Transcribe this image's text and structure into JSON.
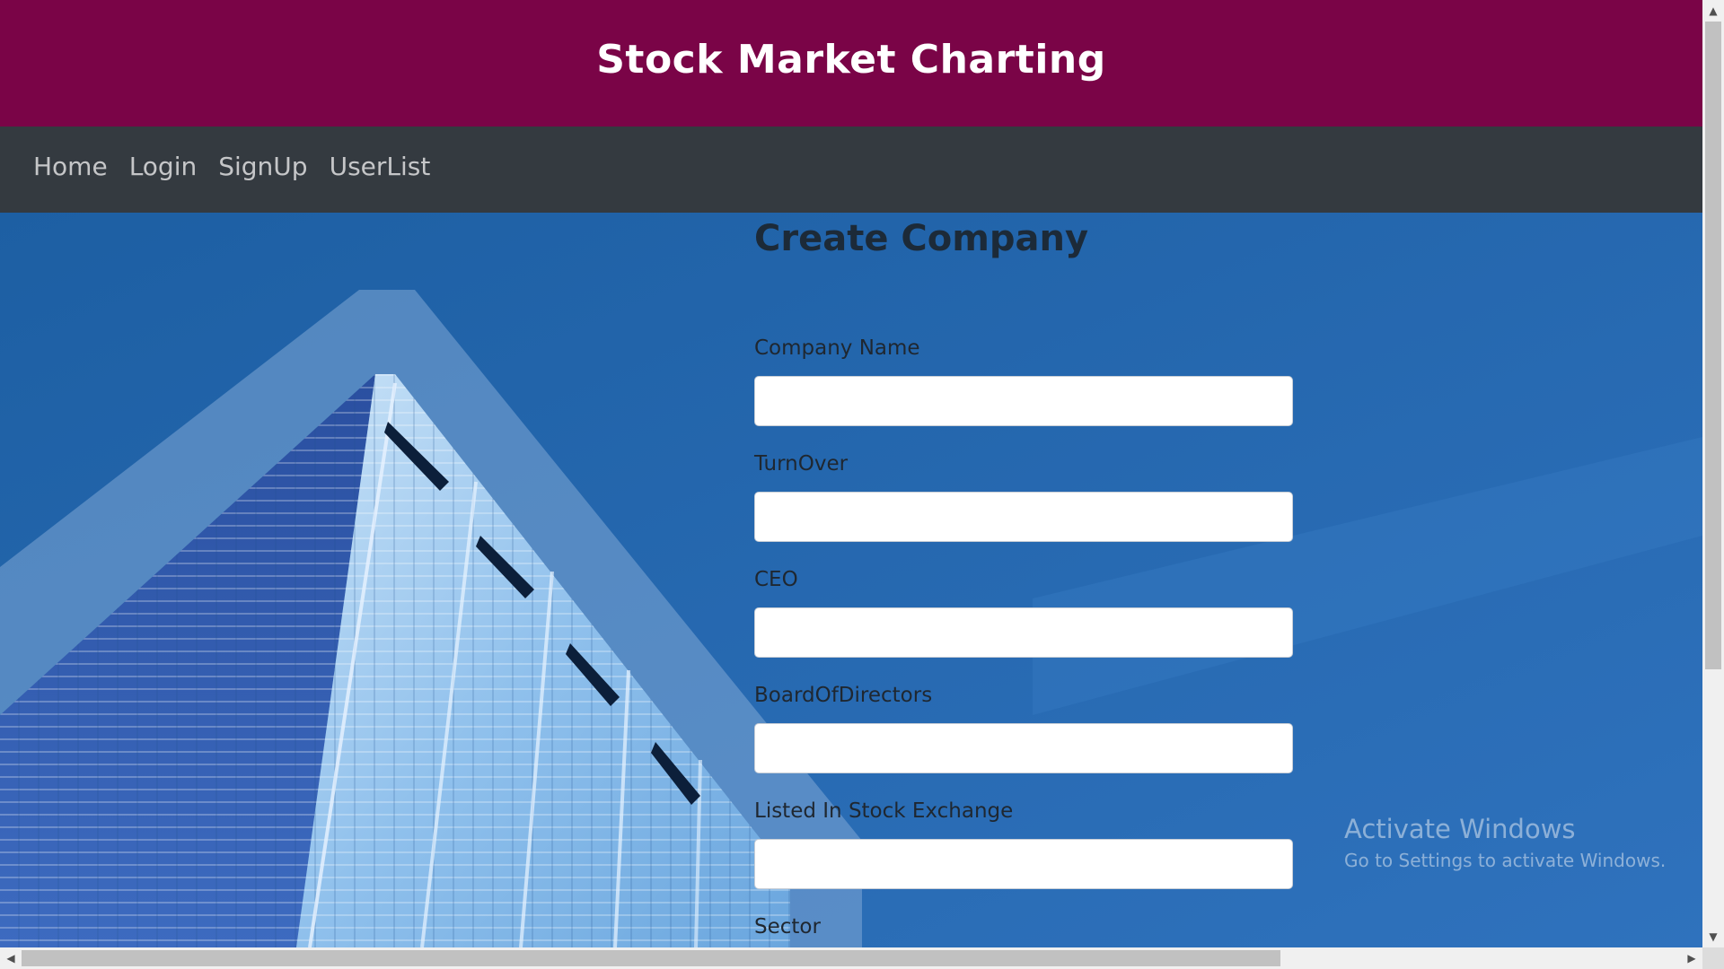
{
  "header": {
    "title": "Stock Market Charting"
  },
  "nav": {
    "items": [
      {
        "label": "Home"
      },
      {
        "label": "Login"
      },
      {
        "label": "SignUp"
      },
      {
        "label": "UserList"
      }
    ]
  },
  "form": {
    "title": "Create Company",
    "fields": [
      {
        "label": "Company Name",
        "value": ""
      },
      {
        "label": "TurnOver",
        "value": ""
      },
      {
        "label": "CEO",
        "value": ""
      },
      {
        "label": "BoardOfDirectors",
        "value": ""
      },
      {
        "label": "Listed In Stock Exchange",
        "value": ""
      },
      {
        "label": "Sector",
        "value": ""
      }
    ]
  },
  "watermark": {
    "title": "Activate Windows",
    "subtitle": "Go to Settings to activate Windows."
  },
  "scrollbars": {
    "arrow_up": "▲",
    "arrow_down": "▼",
    "arrow_left": "◀",
    "arrow_right": "▶"
  },
  "colors": {
    "header_bg": "#7a0447",
    "nav_bg": "#343a40",
    "main_bg": "#2668b3"
  }
}
